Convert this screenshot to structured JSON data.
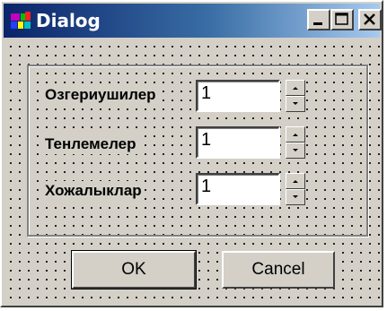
{
  "window": {
    "title": "Dialog",
    "controls": [
      "minimize-icon",
      "maximize-icon",
      "close-icon"
    ]
  },
  "fields": [
    {
      "label": "Озгериушилер",
      "value": "1"
    },
    {
      "label": "Тенлемелер",
      "value": "1"
    },
    {
      "label": "Хожалыклар",
      "value": "1"
    }
  ],
  "buttons": {
    "ok": "OK",
    "cancel": "Cancel"
  },
  "colors": {
    "face": "#d4d0c8",
    "title_start": "#0a246a",
    "title_end": "#a6caf0",
    "title_text": "#ffffff"
  }
}
